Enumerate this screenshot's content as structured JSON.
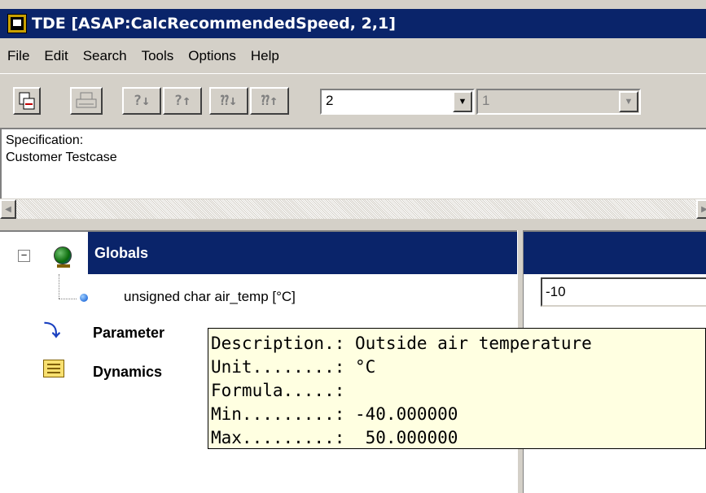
{
  "window": {
    "title": "TDE [ASAP:CalcRecommendedSpeed, 2,1]"
  },
  "menu": {
    "items": [
      "File",
      "Edit",
      "Search",
      "Tools",
      "Options",
      "Help"
    ]
  },
  "toolbar": {
    "buttons": [
      {
        "icon": "open-icon"
      },
      {
        "icon": "print-icon"
      },
      {
        "label": "?↓"
      },
      {
        "label": "?↑"
      },
      {
        "label": "⁇↓"
      },
      {
        "label": "⁇↑"
      }
    ],
    "combo1": {
      "value": "2"
    },
    "combo2": {
      "value": "1"
    }
  },
  "specification": {
    "lines": [
      "Specification:",
      "Customer Testcase"
    ]
  },
  "tree": {
    "globals": {
      "label": "Globals",
      "expander": "−"
    },
    "leaf": {
      "label": "unsigned char air_temp [°C]"
    },
    "parameter": {
      "label": "Parameter"
    },
    "dynamics": {
      "label": "Dynamics"
    }
  },
  "value_field": {
    "value": "-10"
  },
  "tooltip": {
    "lines": [
      "Description.: Outside air temperature",
      "Unit........: °C",
      "Formula.....:",
      "Min.........: -40.000000",
      "Max.........:  50.000000"
    ]
  },
  "colors": {
    "selection": "#0a246a",
    "face": "#d4d0c8",
    "tooltip_bg": "#ffffe1"
  }
}
